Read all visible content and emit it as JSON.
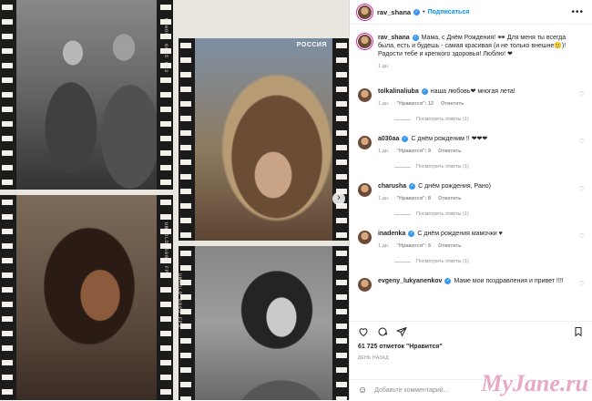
{
  "post": {
    "username": "rav_shana",
    "follow_label": "Подписаться",
    "tv_logo": "РОССИЯ",
    "film_text": "UNHOLD 6005 FP3"
  },
  "caption": {
    "username": "rav_shana",
    "text": "Мама, с Днём Рождения! 🕶 Для меня ты всегда была, есть и будешь - самая красивая (и не только внешне🙂)! Радости тебе и крепкого здоровья! Люблю! ❤",
    "time": "1 дн."
  },
  "comments": [
    {
      "user": "tolkalinaliuba",
      "verified": true,
      "text": "наша любовь❤ многая лета!",
      "time": "1 дн.",
      "likes": "\"Нравится\": 12",
      "reply_label": "Ответить",
      "replies": "Посмотреть ответы (1)"
    },
    {
      "user": "a030aa",
      "verified": true,
      "text": "С днём рожденим !! ❤❤❤",
      "time": "1 дн.",
      "likes": "\"Нравится\": 9",
      "reply_label": "Ответить",
      "replies": "Посмотреть ответы (1)"
    },
    {
      "user": "charusha",
      "verified": true,
      "text": "С днём рождения, Рано)",
      "time": "1 дн.",
      "likes": "\"Нравится\": 8",
      "reply_label": "Ответить",
      "replies": "Посмотреть ответы (1)"
    },
    {
      "user": "inadenka",
      "verified": true,
      "text": "С днём рождения мамочки ♥",
      "time": "1 дн.",
      "likes": "\"Нравится\": 6",
      "reply_label": "Ответить",
      "replies": "Посмотреть ответы (1)"
    },
    {
      "user": "evgeny_lukyanenkov",
      "verified": true,
      "text": "Маме мои поздравления и привет !!!!",
      "time": "",
      "likes": "",
      "reply_label": "",
      "replies": ""
    }
  ],
  "actions": {
    "likes_text": "61 725 отметок \"Нравится\"",
    "date_text": "ДЕНЬ НАЗАД",
    "comment_placeholder": "Добавьте комментарий..."
  },
  "watermark": "MyJane.ru",
  "colors": {
    "link": "#0095f6",
    "verified": "#3897f0",
    "heart": "#ed4956",
    "muted": "#8e8e8e"
  }
}
